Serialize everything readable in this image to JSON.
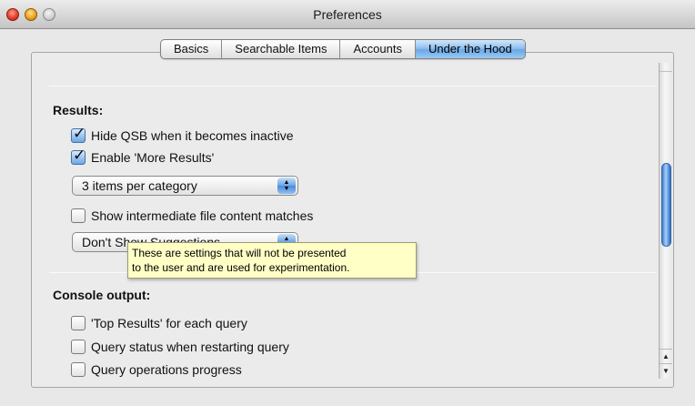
{
  "window": {
    "title": "Preferences"
  },
  "tabs": [
    {
      "label": "Basics",
      "selected": false
    },
    {
      "label": "Searchable Items",
      "selected": false
    },
    {
      "label": "Accounts",
      "selected": false
    },
    {
      "label": "Under the Hood",
      "selected": true
    }
  ],
  "results": {
    "heading": "Results:",
    "hide_qsb": {
      "label": "Hide QSB when it becomes inactive",
      "checked": true
    },
    "enable_more_results": {
      "label": "Enable 'More Results'",
      "checked": true
    },
    "items_per_category": {
      "value": "3 items per category"
    },
    "show_intermediate": {
      "label": "Show intermediate file content matches",
      "checked": false
    },
    "suggestions": {
      "value": "Don't Show Suggestions"
    }
  },
  "tooltip": {
    "line1": "These are settings that will not be presented",
    "line2": "to the user and are used for experimentation."
  },
  "console": {
    "heading": "Console output:",
    "top_results": {
      "label": "'Top Results' for each query",
      "checked": false
    },
    "query_status": {
      "label": "Query status when restarting query",
      "checked": false
    },
    "query_operations": {
      "label": "Query operations progress",
      "checked": false
    }
  },
  "colors": {
    "tab_selected": "#8fc0ef",
    "tooltip_bg": "#ffffc6",
    "scroll_thumb": "#5f9ae0"
  }
}
